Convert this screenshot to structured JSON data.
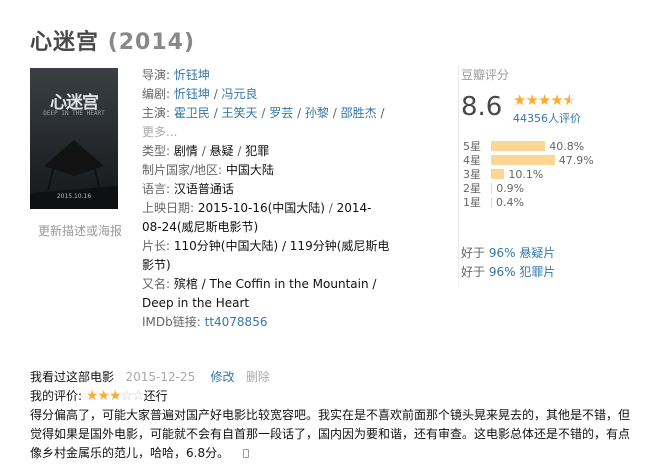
{
  "title": "心迷宫",
  "year": "(2014)",
  "poster": {
    "title": "心迷宫",
    "subtitle": "DEEP IN THE HEART",
    "date": "2015.10.16",
    "update_link": "更新描述或海报"
  },
  "info": {
    "director_label": "导演: ",
    "director": "忻钰坤",
    "writer_label": "编剧: ",
    "writers": [
      "忻钰坤",
      "冯元良"
    ],
    "cast_label": "主演: ",
    "cast": [
      "霍卫民",
      "王笑天",
      "罗芸",
      "孙黎",
      "邵胜杰"
    ],
    "cast_more": "更多...",
    "genre_label": "类型: ",
    "genres": [
      "剧情",
      "悬疑",
      "犯罪"
    ],
    "country_label": "制片国家/地区: ",
    "country": "中国大陆",
    "language_label": "语言: ",
    "language": "汉语普通话",
    "release_label": "上映日期: ",
    "release": [
      "2015-10-16(中国大陆)",
      "2014-08-24(威尼斯电影节)"
    ],
    "runtime_label": "片长: ",
    "runtime": "110分钟(中国大陆) / 119分钟(威尼斯电影节)",
    "aka_label": "又名: ",
    "aka": "殡棺 / The Coffin in the Mountain / Deep in the Heart",
    "imdb_label": "IMDb链接: ",
    "imdb": "tt4078856"
  },
  "rating": {
    "header": "豆瓣评分",
    "score": "8.6",
    "stars_fraction": 0.86,
    "votes": "44356人评价",
    "bars": [
      {
        "label": "5星",
        "percent": 40.8,
        "text": "40.8%"
      },
      {
        "label": "4星",
        "percent": 47.9,
        "text": "47.9%"
      },
      {
        "label": "3星",
        "percent": 10.1,
        "text": "10.1%"
      },
      {
        "label": "2星",
        "percent": 0.9,
        "text": "0.9%"
      },
      {
        "label": "1星",
        "percent": 0.4,
        "text": "0.4%"
      }
    ],
    "better_than": [
      {
        "prefix": "好于 ",
        "link": "96% 悬疑片"
      },
      {
        "prefix": "好于 ",
        "link": "96% 犯罪片"
      }
    ]
  },
  "review": {
    "status": "我看过这部电影",
    "date": "2015-12-25",
    "edit": "修改",
    "delete": "删除",
    "my_rating_label": "我的评价: ",
    "my_stars": 3,
    "my_rating_text": "还行",
    "body": "得分偏高了，可能大家普遍对国产好电影比较宽容吧。我实在是不喜欢前面那个镜头晃来晃去的，其他是不错，但觉得如果是国外电影，可能就不会有自首那一段话了，国内因为要和谐，还有审查。这电影总体还是不错的，有点像乡村金属乐的范儿，哈哈，6.8分。"
  }
}
